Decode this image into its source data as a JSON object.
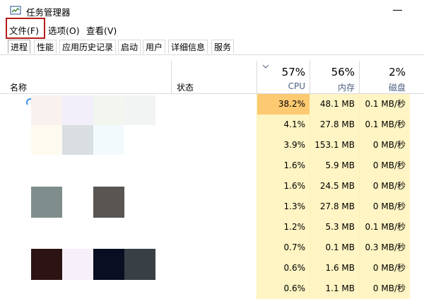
{
  "window": {
    "title": "任务管理器"
  },
  "menu": {
    "file": "文件(F)",
    "options": "选项(O)",
    "view": "查看(V)"
  },
  "tabs": [
    "进程",
    "性能",
    "应用历史记录",
    "启动",
    "用户",
    "详细信息",
    "服务"
  ],
  "columns": {
    "name": "名称",
    "status": "状态",
    "cpu": {
      "percent": "57%",
      "label": "CPU"
    },
    "memory": {
      "percent": "56%",
      "label": "内存"
    },
    "disk": {
      "percent": "2%",
      "label": "磁盘"
    }
  },
  "rows": [
    {
      "cpu": "38.2%",
      "memory": "48.1 MB",
      "disk": "0.1 MB/秒"
    },
    {
      "cpu": "4.1%",
      "memory": "27.8 MB",
      "disk": "0.1 MB/秒"
    },
    {
      "cpu": "3.9%",
      "memory": "153.1 MB",
      "disk": "0 MB/秒"
    },
    {
      "cpu": "1.6%",
      "memory": "5.9 MB",
      "disk": "0 MB/秒"
    },
    {
      "cpu": "1.6%",
      "memory": "24.5 MB",
      "disk": "0 MB/秒"
    },
    {
      "cpu": "1.3%",
      "memory": "27.8 MB",
      "disk": "0 MB/秒"
    },
    {
      "cpu": "1.2%",
      "memory": "5.3 MB",
      "disk": "0.1 MB/秒"
    },
    {
      "cpu": "0.7%",
      "memory": "0.1 MB",
      "disk": "0.3 MB/秒"
    },
    {
      "cpu": "0.6%",
      "memory": "1.6 MB",
      "disk": "0 MB/秒"
    },
    {
      "cpu": "0.6%",
      "memory": "1.1 MB",
      "disk": "0 MB/秒"
    }
  ],
  "colors": {
    "heat_high": "#fdca71",
    "heat_low": "#fff4c3",
    "highlight_border": "#b71c1c",
    "header_label": "#4d6082"
  },
  "icons": {
    "app": "task-manager-icon",
    "sort": "chevron-down-icon",
    "loading": "loading-spinner-icon"
  }
}
